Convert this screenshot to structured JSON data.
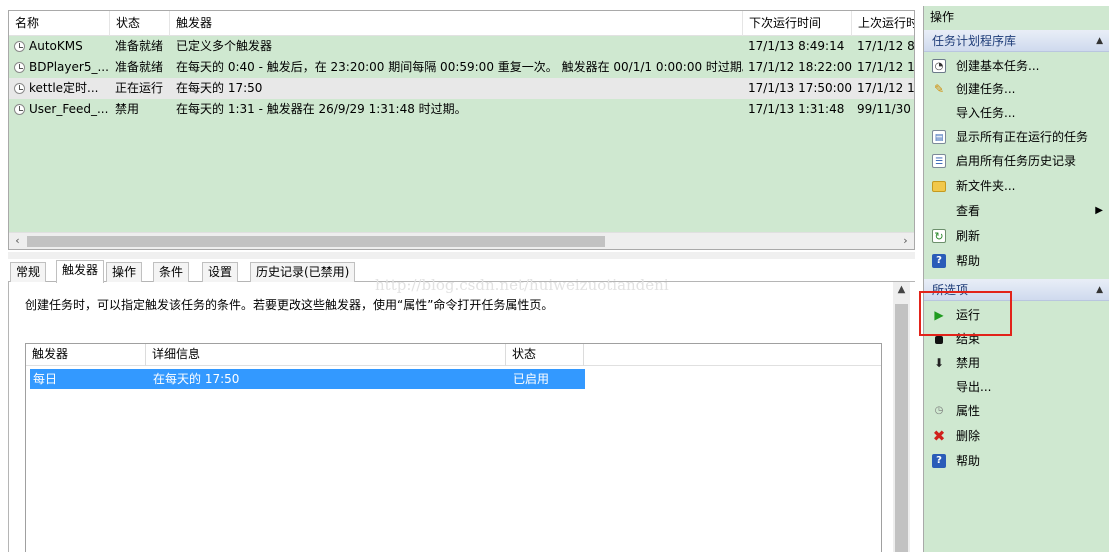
{
  "task_list": {
    "columns": [
      "名称",
      "状态",
      "触发器",
      "下次运行时间",
      "上次运行时"
    ],
    "rows": [
      {
        "name": "AutoKMS",
        "status": "准备就绪",
        "trigger": "已定义多个触发器",
        "next_run": "17/1/13 8:49:14",
        "last_run": "17/1/12 8"
      },
      {
        "name": "BDPlayer5_...",
        "status": "准备就绪",
        "trigger": "在每天的 0:40 - 触发后，在 23:20:00 期间每隔 00:59:00 重复一次。 触发器在 00/1/1 0:00:00 时过期。",
        "next_run": "17/1/12 18:22:00",
        "last_run": "17/1/12 1"
      },
      {
        "name": "kettle定时...",
        "status": "正在运行",
        "trigger": "在每天的 17:50",
        "next_run": "17/1/13 17:50:00",
        "last_run": "17/1/12 1"
      },
      {
        "name": "User_Feed_...",
        "status": "禁用",
        "trigger": "在每天的 1:31 - 触发器在 26/9/29 1:31:48 时过期。",
        "next_run": "17/1/13 1:31:48",
        "last_run": "99/11/30"
      }
    ],
    "scroll_left": "‹",
    "scroll_right": "›"
  },
  "tabs": [
    "常规",
    "触发器",
    "操作",
    "条件",
    "设置",
    "历史记录(已禁用)"
  ],
  "active_tab": "触发器",
  "detail": {
    "description": "创建任务时，可以指定触发该任务的条件。若要更改这些触发器，使用“属性”命令打开任务属性页。",
    "watermark": "http://blog.csdn.net/huiweizuotiandeni",
    "trigger_table": {
      "columns": [
        "触发器",
        "详细信息",
        "状态"
      ],
      "rows": [
        {
          "trigger": "每日",
          "details": "在每天的 17:50",
          "status": "已启用"
        }
      ]
    }
  },
  "actions": {
    "title": "操作",
    "library_section": {
      "title": "任务计划程序库",
      "items": [
        {
          "label": "创建基本任务...",
          "icon": "create-basic-task-icon"
        },
        {
          "label": "创建任务...",
          "icon": "create-task-icon"
        },
        {
          "label": "导入任务...",
          "icon": ""
        },
        {
          "label": "显示所有正在运行的任务",
          "icon": "running-tasks-icon"
        },
        {
          "label": "启用所有任务历史记录",
          "icon": "history-icon"
        },
        {
          "label": "新文件夹...",
          "icon": "folder-icon"
        },
        {
          "label": "查看",
          "icon": ""
        },
        {
          "label": "刷新",
          "icon": "refresh-icon"
        },
        {
          "label": "帮助",
          "icon": "help-icon"
        }
      ]
    },
    "selected_section": {
      "title": "所选项",
      "items": [
        {
          "label": "运行",
          "icon": "run-icon"
        },
        {
          "label": "结束",
          "icon": "stop-icon"
        },
        {
          "label": "禁用",
          "icon": "disable-icon"
        },
        {
          "label": "导出...",
          "icon": ""
        },
        {
          "label": "属性",
          "icon": "properties-icon"
        },
        {
          "label": "删除",
          "icon": "delete-icon"
        },
        {
          "label": "帮助",
          "icon": "help-icon"
        }
      ]
    }
  },
  "colors": {
    "pane_bg": "#cfe8d0",
    "selection": "#3399ff",
    "highlight_box": "#e2231a"
  }
}
